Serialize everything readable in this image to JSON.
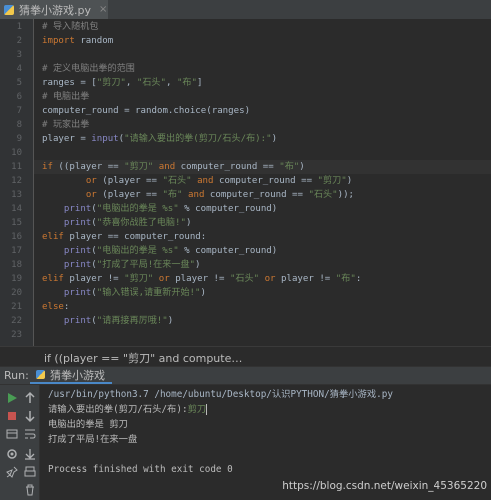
{
  "editor_tab": {
    "file_name": "猜拳小游戏.py",
    "close_glyph": "×",
    "icon": "python-file-icon"
  },
  "code_lines": [
    {
      "n": "1",
      "segs": [
        [
          "cm",
          "# 导入随机包"
        ]
      ]
    },
    {
      "n": "2",
      "segs": [
        [
          "kw",
          "import"
        ],
        [
          "pl",
          " random"
        ]
      ]
    },
    {
      "n": "3",
      "segs": []
    },
    {
      "n": "4",
      "segs": [
        [
          "cm",
          "# 定义电脑出拳的范围"
        ]
      ]
    },
    {
      "n": "5",
      "segs": [
        [
          "pl",
          "ranges = ["
        ],
        [
          "str",
          "\"剪刀\""
        ],
        [
          "pl",
          ", "
        ],
        [
          "str",
          "\"石头\""
        ],
        [
          "pl",
          ", "
        ],
        [
          "str",
          "\"布\""
        ],
        [
          "pl",
          "]"
        ]
      ]
    },
    {
      "n": "6",
      "segs": [
        [
          "cm",
          "# 电脑出拳"
        ]
      ]
    },
    {
      "n": "7",
      "segs": [
        [
          "pl",
          "computer_round = random.choice(ranges)"
        ]
      ]
    },
    {
      "n": "8",
      "segs": [
        [
          "cm",
          "# 玩家出拳"
        ]
      ]
    },
    {
      "n": "9",
      "segs": [
        [
          "pl",
          "player = "
        ],
        [
          "bi",
          "input"
        ],
        [
          "pl",
          "("
        ],
        [
          "str",
          "\"请输入要出的拳(剪刀/石头/布):\""
        ],
        [
          "pl",
          ")"
        ]
      ]
    },
    {
      "n": "10",
      "segs": []
    },
    {
      "n": "11",
      "current": true,
      "segs": [
        [
          "kw",
          "if"
        ],
        [
          "pl",
          " ((player == "
        ],
        [
          "str",
          "\"剪刀\""
        ],
        [
          "kw",
          " and"
        ],
        [
          "pl",
          " computer_round == "
        ],
        [
          "str",
          "\"布\""
        ],
        [
          "pl",
          ")"
        ]
      ]
    },
    {
      "n": "12",
      "segs": [
        [
          "pl",
          "        "
        ],
        [
          "kw",
          "or"
        ],
        [
          "pl",
          " (player == "
        ],
        [
          "str",
          "\"石头\""
        ],
        [
          "kw",
          " and"
        ],
        [
          "pl",
          " computer_round == "
        ],
        [
          "str",
          "\"剪刀\""
        ],
        [
          "pl",
          ")"
        ]
      ]
    },
    {
      "n": "13",
      "segs": [
        [
          "pl",
          "        "
        ],
        [
          "kw",
          "or"
        ],
        [
          "pl",
          " (player == "
        ],
        [
          "str",
          "\"布\""
        ],
        [
          "kw",
          " and"
        ],
        [
          "pl",
          " computer_round == "
        ],
        [
          "str",
          "\"石头\""
        ],
        [
          "pl",
          "));"
        ]
      ]
    },
    {
      "n": "14",
      "segs": [
        [
          "pl",
          "    "
        ],
        [
          "bi",
          "print"
        ],
        [
          "pl",
          "("
        ],
        [
          "str",
          "\"电脑出的拳是 %s\""
        ],
        [
          "pl",
          " % computer_round)"
        ]
      ]
    },
    {
      "n": "15",
      "segs": [
        [
          "pl",
          "    "
        ],
        [
          "bi",
          "print"
        ],
        [
          "pl",
          "("
        ],
        [
          "str",
          "\"恭喜你战胜了电脑!\""
        ],
        [
          "pl",
          ")"
        ]
      ]
    },
    {
      "n": "16",
      "segs": [
        [
          "kw",
          "elif"
        ],
        [
          "pl",
          " player == computer_round:"
        ]
      ]
    },
    {
      "n": "17",
      "segs": [
        [
          "pl",
          "    "
        ],
        [
          "bi",
          "print"
        ],
        [
          "pl",
          "("
        ],
        [
          "str",
          "\"电脑出的拳是 %s\""
        ],
        [
          "pl",
          " % computer_round)"
        ]
      ]
    },
    {
      "n": "18",
      "segs": [
        [
          "pl",
          "    "
        ],
        [
          "bi",
          "print"
        ],
        [
          "pl",
          "("
        ],
        [
          "str",
          "\"打成了平局!在来一盘\""
        ],
        [
          "pl",
          ")"
        ]
      ]
    },
    {
      "n": "19",
      "segs": [
        [
          "kw",
          "elif"
        ],
        [
          "pl",
          " player != "
        ],
        [
          "str",
          "\"剪刀\""
        ],
        [
          "kw",
          " or"
        ],
        [
          "pl",
          " player != "
        ],
        [
          "str",
          "\"石头\""
        ],
        [
          "kw",
          " or"
        ],
        [
          "pl",
          " player != "
        ],
        [
          "str",
          "\"布\""
        ],
        [
          "pl",
          ":"
        ]
      ]
    },
    {
      "n": "20",
      "segs": [
        [
          "pl",
          "    "
        ],
        [
          "bi",
          "print"
        ],
        [
          "pl",
          "("
        ],
        [
          "str",
          "\"输入错误,请重新开始!\""
        ],
        [
          "pl",
          ")"
        ]
      ]
    },
    {
      "n": "21",
      "segs": [
        [
          "kw",
          "else"
        ],
        [
          "pl",
          ":"
        ]
      ]
    },
    {
      "n": "22",
      "segs": [
        [
          "pl",
          "    "
        ],
        [
          "bi",
          "print"
        ],
        [
          "pl",
          "("
        ],
        [
          "str",
          "\"请再接再厉哦!\""
        ],
        [
          "pl",
          ")"
        ]
      ]
    },
    {
      "n": "23",
      "segs": []
    }
  ],
  "breadcrumb": {
    "text": "if ((player == \"剪刀\" and compute…"
  },
  "run_panel": {
    "label": "Run:",
    "tab_label": "猜拳小游戏",
    "command": "/usr/bin/python3.7 /home/ubuntu/Desktop/认识PYTHON/猜拳小游戏.py",
    "prompt": "请输入要出的拳(剪刀/石头/布):",
    "input_value": "剪刀",
    "output_1": "电脑出的拳是 剪刀",
    "output_2": "打成了平局!在来一盘",
    "exit_message": "Process finished with exit code 0"
  },
  "watermark": "https://blog.csdn.net/weixin_45365220",
  "colors": {
    "keyword": "#cc7832",
    "string": "#6a8759",
    "comment": "#808080",
    "builtin": "#8888c6",
    "text": "#a9b7c6",
    "run_green": "#499c54",
    "stop_red": "#c75450"
  }
}
